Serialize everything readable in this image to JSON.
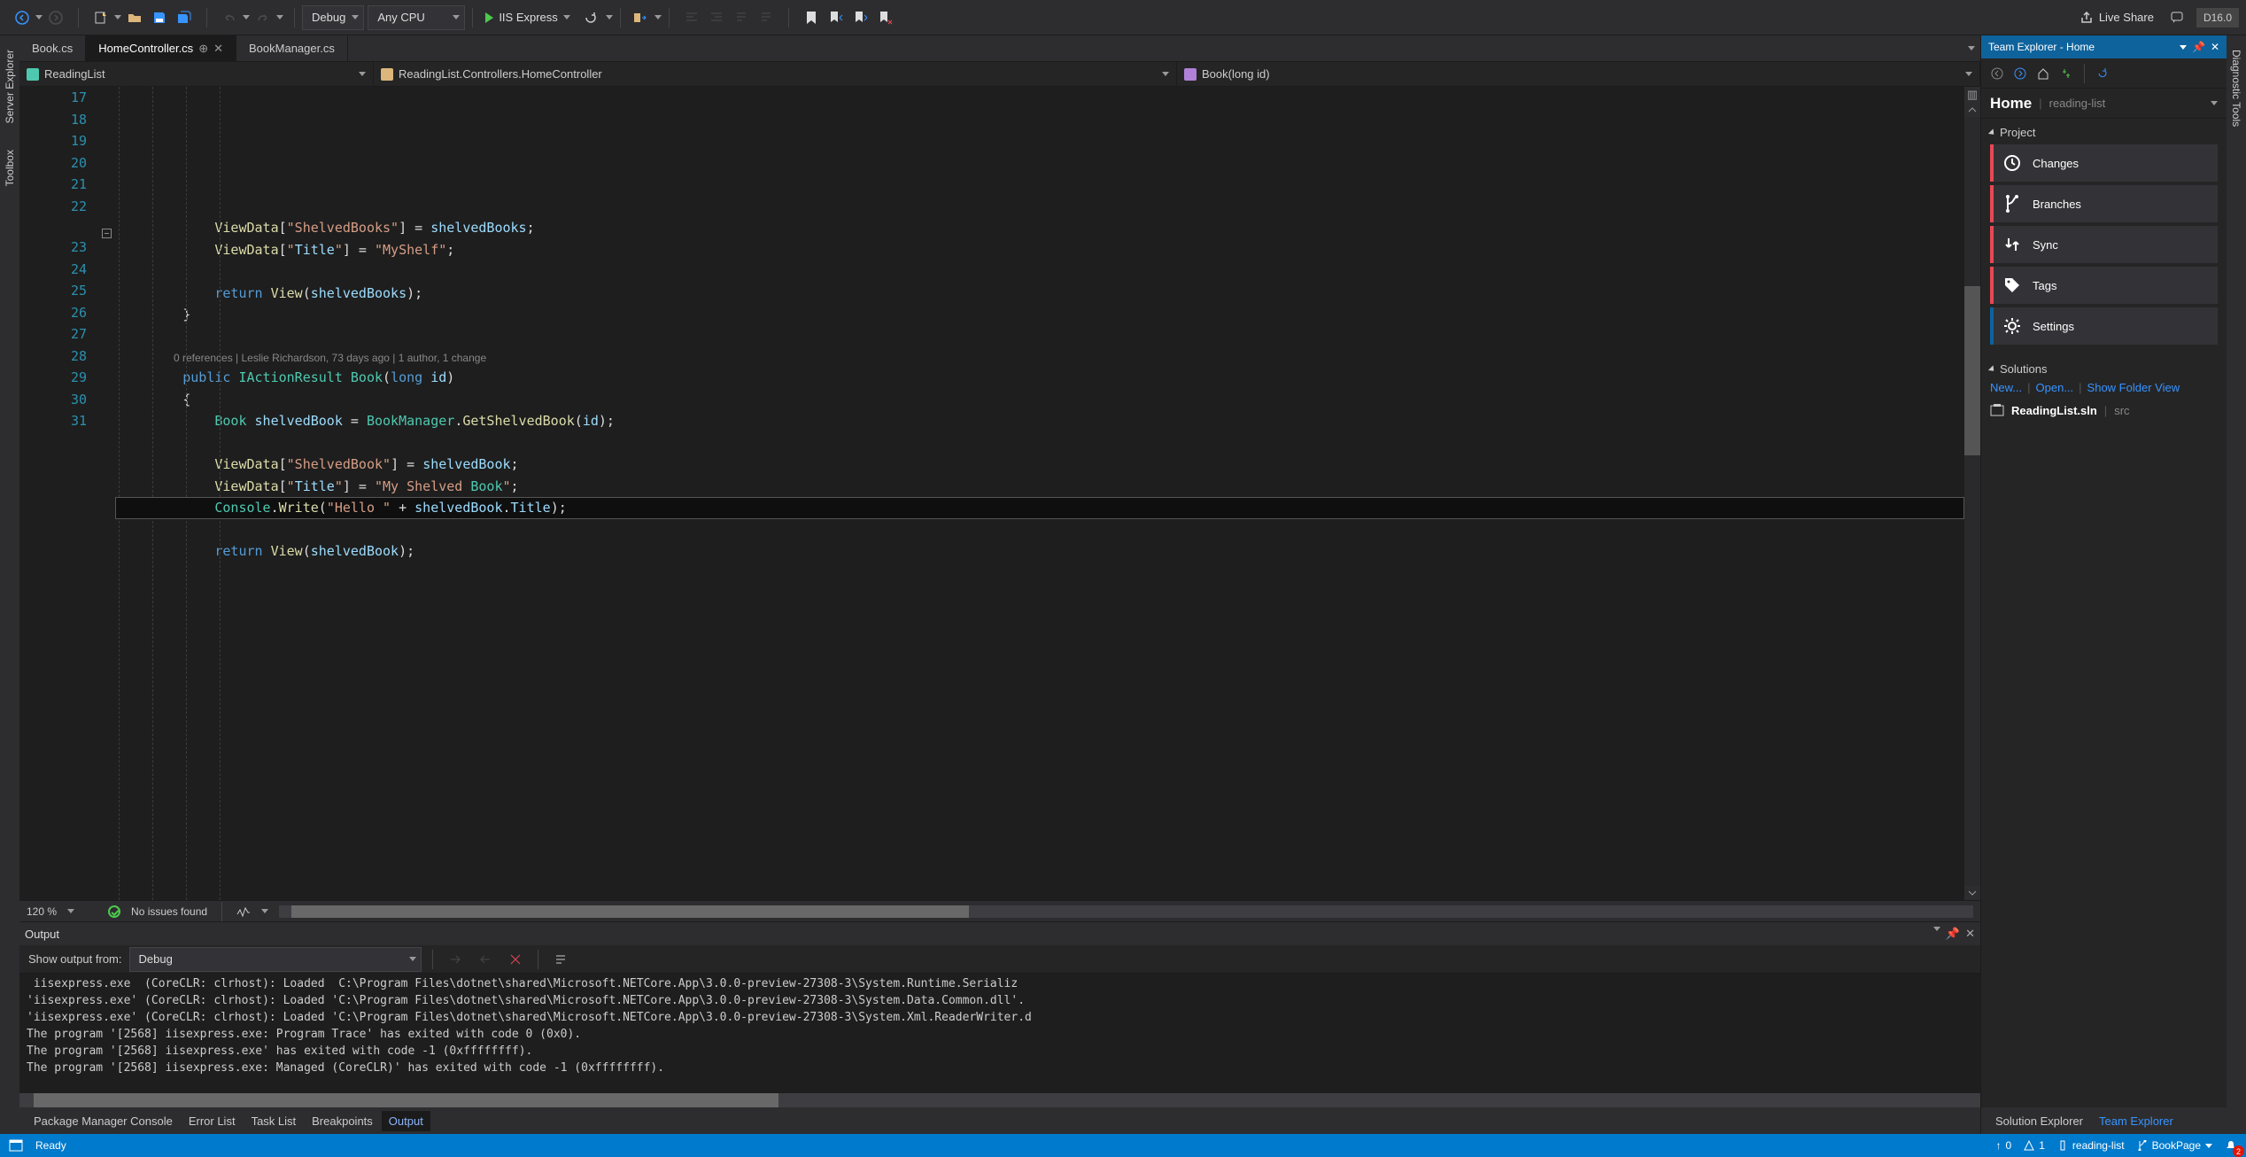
{
  "toolbar": {
    "config_dropdown": "Debug",
    "platform_dropdown": "Any CPU",
    "run_label": "IIS Express",
    "live_share": "Live Share",
    "version": "D16.0"
  },
  "left_rail": [
    "Server Explorer",
    "Toolbox"
  ],
  "right_rail": [
    "Diagnostic Tools"
  ],
  "tabs": [
    {
      "label": "Book.cs",
      "active": false
    },
    {
      "label": "HomeController.cs",
      "active": true,
      "pinned": true
    },
    {
      "label": "BookManager.cs",
      "active": false
    }
  ],
  "nav": {
    "project": "ReadingList",
    "class": "ReadingList.Controllers.HomeController",
    "member": "Book(long id)"
  },
  "editor": {
    "first_line": 17,
    "codelens": "0 references | Leslie Richardson, 73 days ago | 1 author, 1 change",
    "lines": [
      "            ViewData[\"ShelvedBooks\"] = shelvedBooks;",
      "            ViewData[\"Title\"] = \"MyShelf\";",
      "",
      "            return View(shelvedBooks);",
      "        }",
      "",
      "",
      "        public IActionResult Book(long id)",
      "        {",
      "            Book shelvedBook = BookManager.GetShelvedBook(id);",
      "",
      "            ViewData[\"ShelvedBook\"] = shelvedBook;",
      "            ViewData[\"Title\"] = \"My Shelved Book\";",
      "            Console.Write(\"Hello \" + shelvedBook.Title);",
      "",
      "            return View(shelvedBook);"
    ],
    "highlight_line_index": 12,
    "zoom": "120 %",
    "issues": "No issues found"
  },
  "output": {
    "title": "Output",
    "from_label": "Show output from:",
    "from_value": "Debug",
    "lines": [
      " iisexpress.exe  (CoreCLR: clrhost): Loaded  C:\\Program Files\\dotnet\\shared\\Microsoft.NETCore.App\\3.0.0-preview-27308-3\\System.Runtime.Serializ",
      "'iisexpress.exe' (CoreCLR: clrhost): Loaded 'C:\\Program Files\\dotnet\\shared\\Microsoft.NETCore.App\\3.0.0-preview-27308-3\\System.Data.Common.dll'.",
      "'iisexpress.exe' (CoreCLR: clrhost): Loaded 'C:\\Program Files\\dotnet\\shared\\Microsoft.NETCore.App\\3.0.0-preview-27308-3\\System.Xml.ReaderWriter.d",
      "The program '[2568] iisexpress.exe: Program Trace' has exited with code 0 (0x0).",
      "The program '[2568] iisexpress.exe' has exited with code -1 (0xffffffff).",
      "The program '[2568] iisexpress.exe: Managed (CoreCLR)' has exited with code -1 (0xffffffff)."
    ]
  },
  "bottom_tabs": [
    "Package Manager Console",
    "Error List",
    "Task List",
    "Breakpoints",
    "Output"
  ],
  "bottom_tabs_active": "Output",
  "team": {
    "title": "Team Explorer - Home",
    "crumb_big": "Home",
    "crumb_small": "reading-list",
    "section_project": "Project",
    "items": [
      {
        "icon": "clock",
        "label": "Changes"
      },
      {
        "icon": "branch",
        "label": "Branches"
      },
      {
        "icon": "sync",
        "label": "Sync"
      },
      {
        "icon": "tag",
        "label": "Tags"
      },
      {
        "icon": "gear",
        "label": "Settings",
        "cls": "settings"
      }
    ],
    "section_solutions": "Solutions",
    "links": [
      "New...",
      "Open...",
      "Show Folder View"
    ],
    "solution_name": "ReadingList.sln",
    "solution_sub": "src"
  },
  "right_tabs": [
    "Solution Explorer",
    "Team Explorer"
  ],
  "right_tabs_active": "Team Explorer",
  "status": {
    "ready": "Ready",
    "up": "0",
    "down": "1",
    "repo": "reading-list",
    "branch": "BookPage",
    "notif": "2"
  }
}
